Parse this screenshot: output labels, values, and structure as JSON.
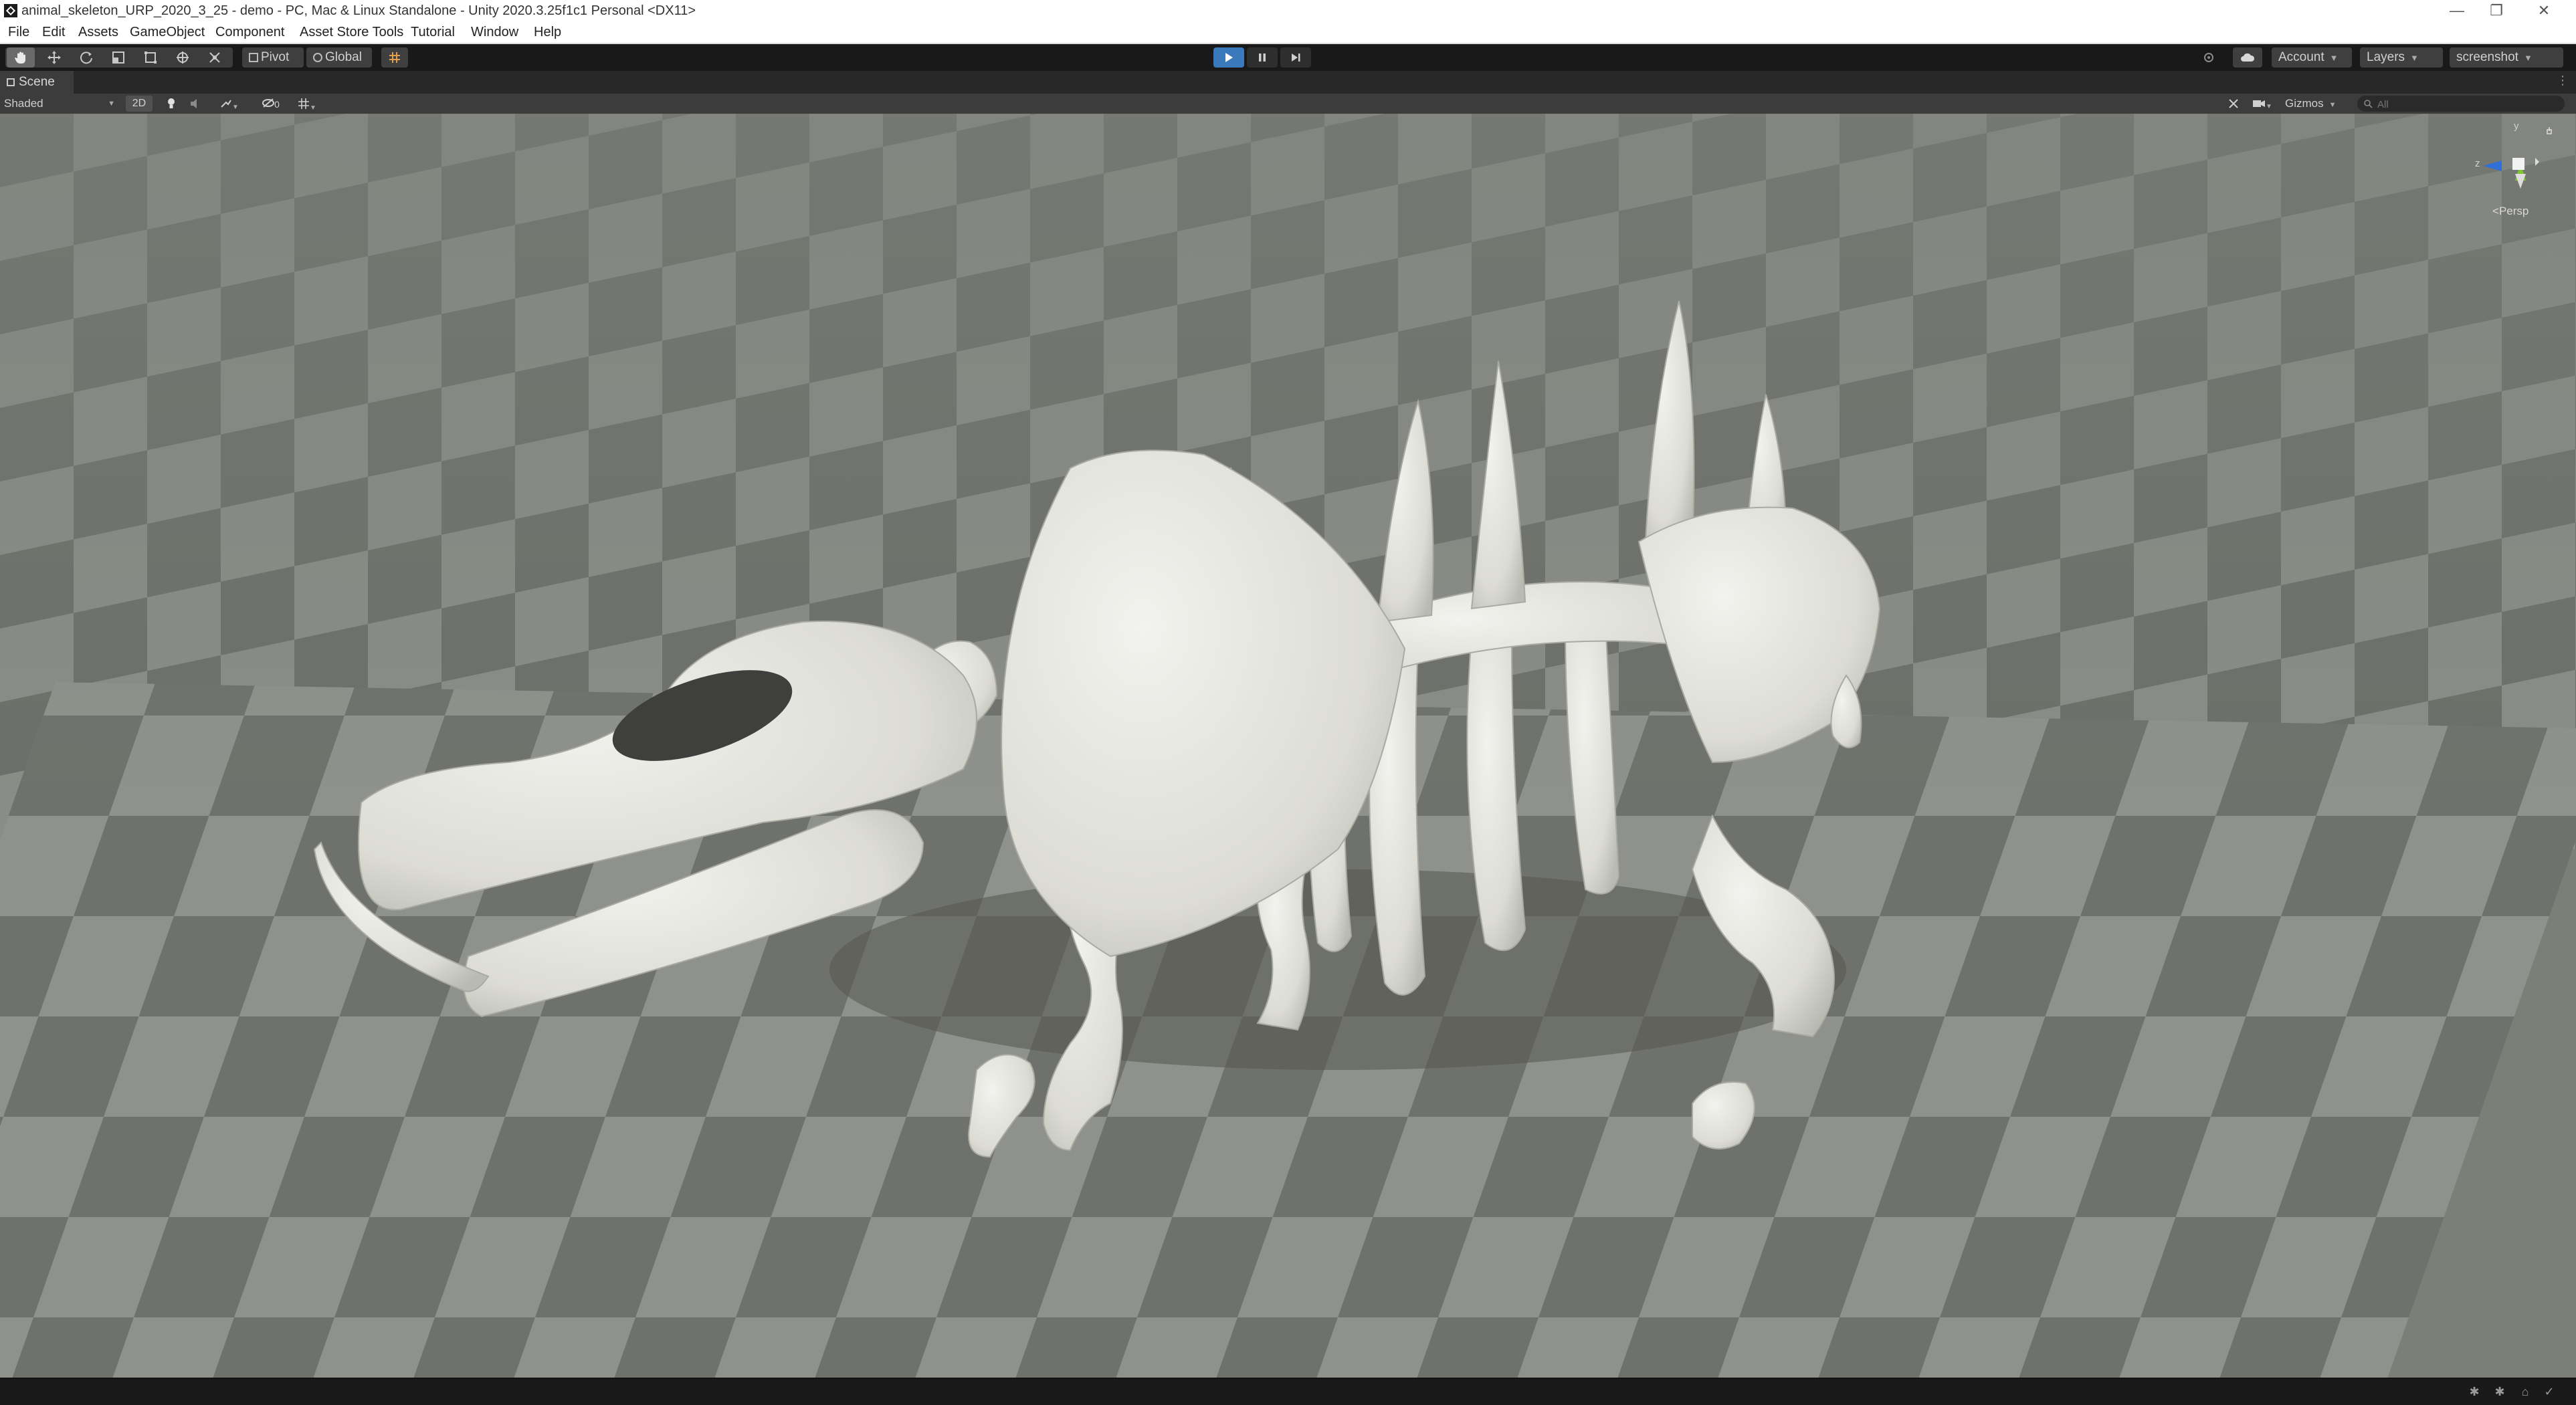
{
  "window": {
    "title": "animal_skeleton_URP_2020_3_25 - demo - PC, Mac & Linux Standalone - Unity 2020.3.25f1c1 Personal <DX11>",
    "buttons": {
      "minimize": "—",
      "restore": "❐",
      "close": "✕"
    }
  },
  "menubar": {
    "items": [
      "File",
      "Edit",
      "Assets",
      "GameObject",
      "Component",
      "Asset Store Tools",
      "Tutorial",
      "Window",
      "Help"
    ]
  },
  "toolbar": {
    "pivot_label": "Pivot",
    "global_label": "Global",
    "account_label": "Account",
    "layers_label": "Layers",
    "layout_label": "screenshot"
  },
  "scene": {
    "tab_label": "Scene",
    "shading_mode": "Shaded",
    "mode_2d_label": "2D",
    "hidden_count": "0",
    "gizmos_label": "Gizmos",
    "search_placeholder": "All",
    "projection_label": "Persp",
    "axis_labels": {
      "y": "y",
      "z": "z"
    }
  },
  "colors": {
    "play_button_active": "#3a79bb",
    "bone": "#e3e3dd",
    "checker_light": "#8f918c",
    "checker_dark": "#6f716c",
    "gizmo_y": "#7dc52e",
    "gizmo_z": "#2e6fd8"
  },
  "icons": {
    "hand_tool": "hand-icon",
    "move_tool": "move-icon",
    "rotate_tool": "rotate-icon",
    "scale_tool": "scale-icon",
    "rect_tool": "rect-icon",
    "transform_tool": "transform-icon",
    "custom_tool": "custom-tool-icon",
    "snap": "grid-snap-icon",
    "play": "play-icon",
    "pause": "pause-icon",
    "step": "step-icon",
    "collab": "collab-icon",
    "cloud": "cloud-icon"
  }
}
